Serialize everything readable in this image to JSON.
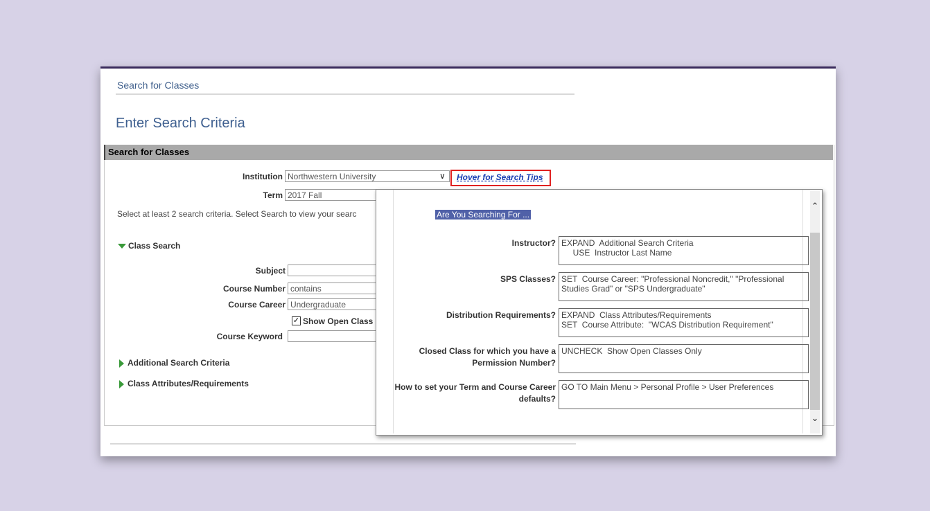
{
  "breadcrumb": "Search for Classes",
  "page_title": "Enter Search Criteria",
  "panel_title": "Search for Classes",
  "institution": {
    "label": "Institution",
    "value": "Northwestern University"
  },
  "term": {
    "label": "Term",
    "value": "2017 Fall"
  },
  "tips_link": "Hover for Search Tips",
  "instructions": "Select at least 2 search criteria. Select Search to view your searc",
  "class_search": {
    "title": "Class Search",
    "subject_label": "Subject",
    "subject_value": "",
    "course_number_label": "Course Number",
    "course_number_value": "contains",
    "course_career_label": "Course Career",
    "course_career_value": "Undergraduate",
    "open_classes_label": "Show Open Class",
    "course_keyword_label": "Course Keyword",
    "course_keyword_value": ""
  },
  "additional_criteria": "Additional Search Criteria",
  "class_attributes": "Class Attributes/Requirements",
  "popup": {
    "heading": "Are You Searching For ...",
    "items": [
      {
        "question": "Instructor?",
        "answer": "EXPAND  Additional Search Criteria\n     USE  Instructor Last Name"
      },
      {
        "question": "SPS Classes?",
        "answer": "SET  Course Career: \"Professional Noncredit,\" \"Professional Studies Grad\" or \"SPS Undergraduate\""
      },
      {
        "question": "Distribution Requirements?",
        "answer": "EXPAND  Class Attributes/Requirements\nSET  Course Attribute:  \"WCAS Distribution Requirement\""
      },
      {
        "question": "Closed Class for which you have a Permission Number?",
        "answer": "UNCHECK  Show Open Classes Only"
      },
      {
        "question": "How to set your Term and Course Career defaults?",
        "answer": "GO TO Main Menu > Personal Profile > User Preferences"
      }
    ]
  }
}
